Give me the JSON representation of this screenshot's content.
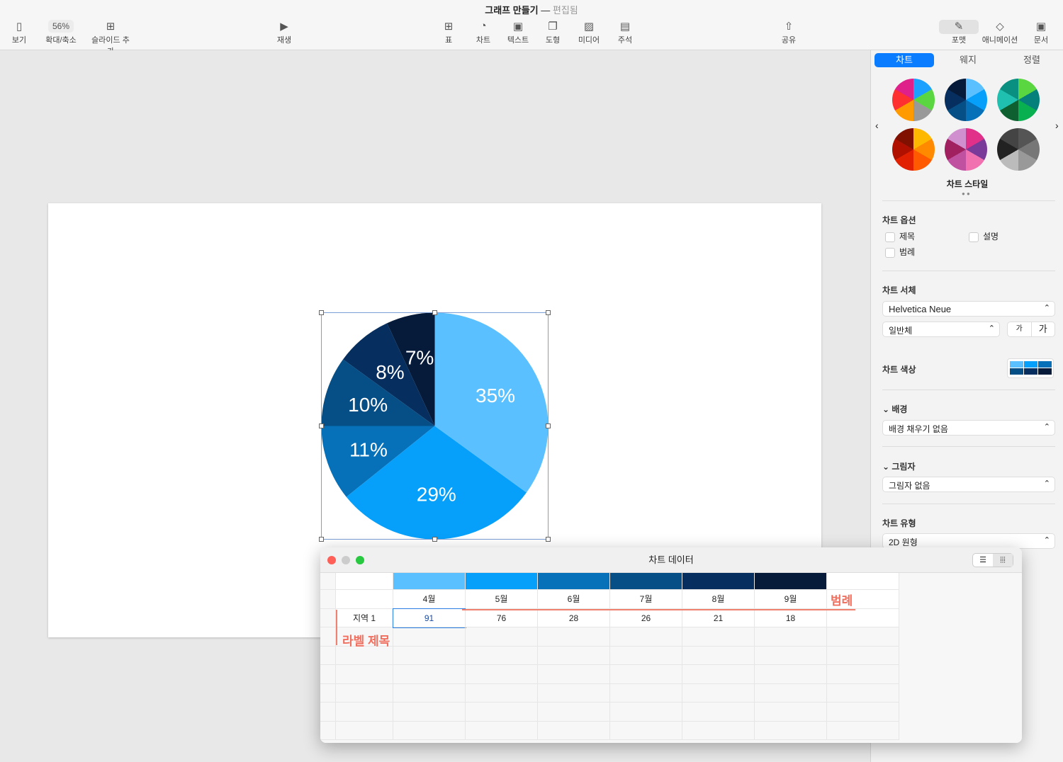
{
  "window": {
    "title": "그래프 만들기",
    "status": "편집됨"
  },
  "toolbar": {
    "view": "보기",
    "zoom_value": "56%",
    "zoom": "확대/축소",
    "add_slide": "슬라이드 추가",
    "play": "재생",
    "table": "표",
    "chart": "차트",
    "text": "텍스트",
    "shape": "도형",
    "media": "미디어",
    "comment": "주석",
    "share": "공유",
    "format": "포맷",
    "animate": "애니메이션",
    "document": "문서"
  },
  "panel": {
    "tabs": [
      "차트",
      "웨지",
      "정렬"
    ],
    "chart_style": "차트 스타일",
    "chart_options": "차트 옵션",
    "opt_title": "제목",
    "opt_caption": "설명",
    "opt_legend": "범례",
    "chart_font": "차트 서체",
    "font": "Helvetica Neue",
    "font_style": "일반체",
    "size_small": "가",
    "size_large": "가",
    "chart_colors": "차트 색상",
    "background": "배경",
    "background_value": "배경 채우기 없음",
    "shadow": "그림자",
    "shadow_value": "그림자 없음",
    "chart_type": "차트 유형",
    "chart_type_value": "2D 원형"
  },
  "data_window": {
    "title": "차트 데이터",
    "row_label": "지역 1",
    "legend_annotation": "범례",
    "label_annotation": "라벨 제목"
  },
  "chart_data": {
    "type": "pie",
    "categories": [
      "4월",
      "5월",
      "6월",
      "7월",
      "8월",
      "9월"
    ],
    "values": [
      91,
      76,
      28,
      26,
      21,
      18
    ],
    "labels": [
      "35%",
      "29%",
      "11%",
      "10%",
      "8%",
      "7%"
    ],
    "colors": [
      "#5ac0ff",
      "#06a0fa",
      "#0671b8",
      "#064e86",
      "#062e5e",
      "#061a3a"
    ]
  }
}
